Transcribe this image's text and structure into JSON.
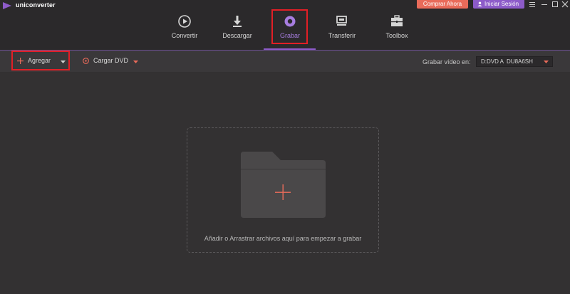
{
  "app": {
    "name": "uniconverter",
    "logo_icon": "play-triangle-icon"
  },
  "header": {
    "buy_label": "Comprar Ahora",
    "login_label": "Iniciar Sesión"
  },
  "nav": {
    "items": [
      {
        "label": "Convertir",
        "icon": "convert-icon"
      },
      {
        "label": "Descargar",
        "icon": "download-icon"
      },
      {
        "label": "Grabar",
        "icon": "burn-icon",
        "active": true
      },
      {
        "label": "Transferir",
        "icon": "transfer-icon"
      },
      {
        "label": "Toolbox",
        "icon": "toolbox-icon"
      }
    ]
  },
  "toolbar": {
    "add_label": "Agregar",
    "load_dvd_label": "Cargar DVD",
    "burn_target_label": "Grabar vídeo en:",
    "burn_target_value": "D:DVD A  DU8A6SH"
  },
  "dropzone": {
    "hint": "Añadir o Arrastrar archivos aquí para empezar a grabar"
  },
  "colors": {
    "accent_purple": "#8d5bc9",
    "accent_red": "#e96b5a",
    "highlight_red": "#e21f26",
    "background": "#333132"
  }
}
